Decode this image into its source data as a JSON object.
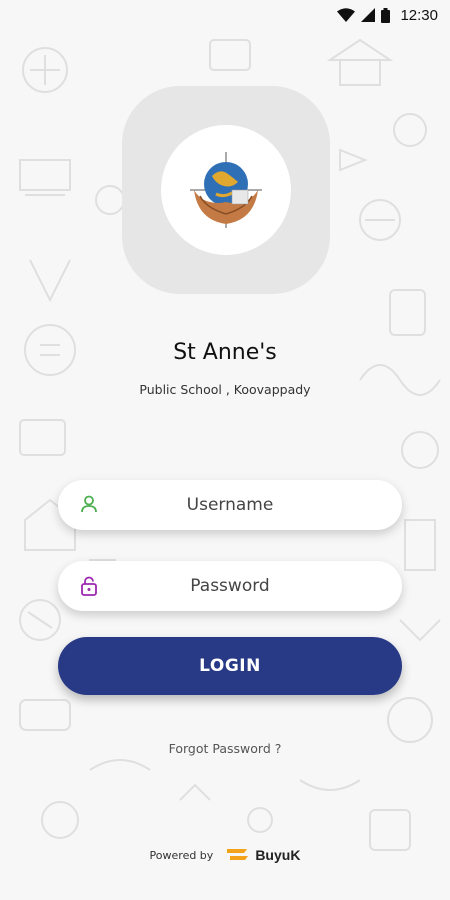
{
  "status_bar": {
    "time": "12:30",
    "icons": [
      "wifi-icon",
      "signal-icon",
      "battery-icon"
    ]
  },
  "school": {
    "name": "St Anne's",
    "subtitle": "Public School , Koovappady"
  },
  "form": {
    "username_placeholder": "Username",
    "password_placeholder": "Password",
    "login_label": "LOGIN",
    "forgot_label": "Forgot Password ?"
  },
  "footer": {
    "powered_by": "Powered by",
    "brand_name": "BuyuK"
  },
  "colors": {
    "primary": "#283a86",
    "user_icon": "#4caf50",
    "lock_icon": "#9c27b0",
    "brand_accent": "#f2a31b"
  }
}
